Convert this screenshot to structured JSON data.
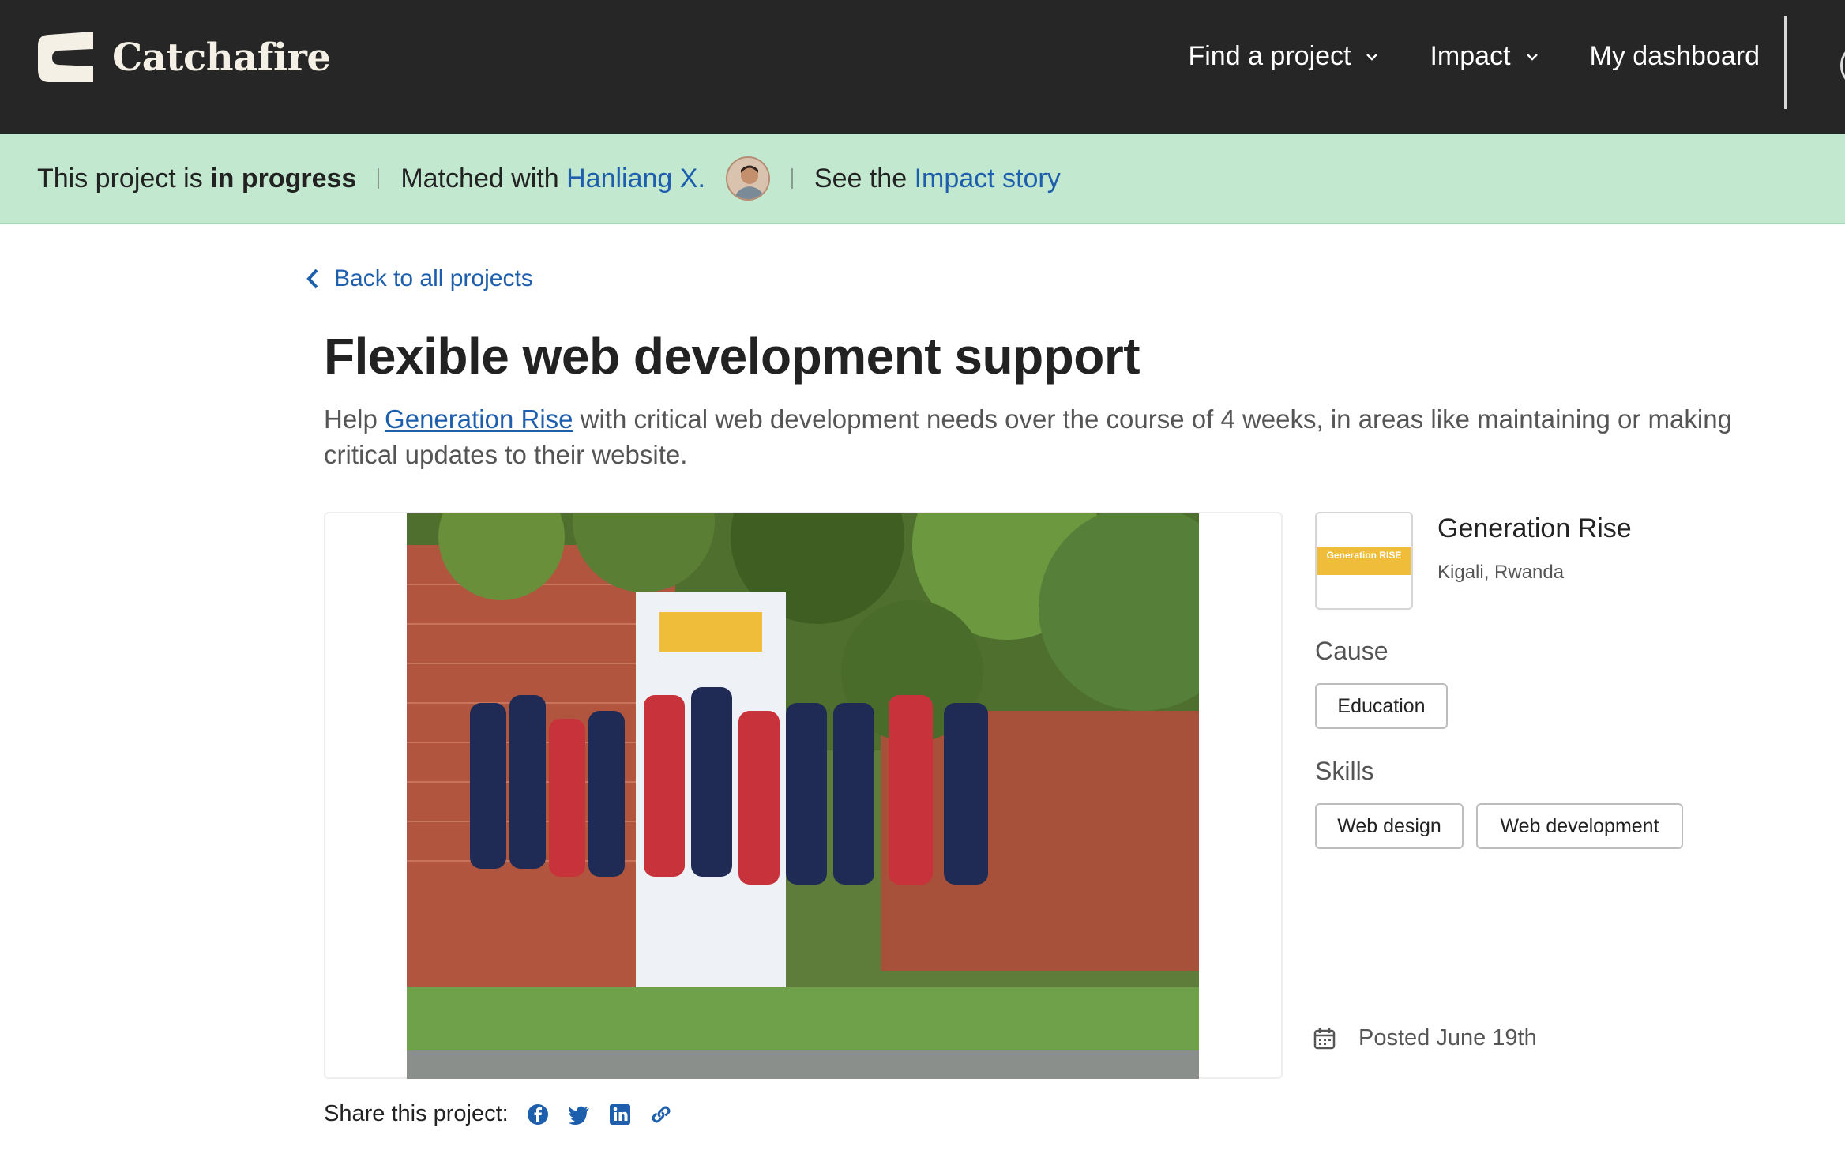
{
  "brand": {
    "name": "Catchafire"
  },
  "nav": {
    "items": [
      {
        "label": "Find a project",
        "dropdown": true
      },
      {
        "label": "Impact",
        "dropdown": true
      },
      {
        "label": "My dashboard",
        "dropdown": false
      }
    ]
  },
  "status": {
    "prefix": "This project is ",
    "state": "in progress",
    "matched_prefix": "Matched with ",
    "matched_name": "Hanliang X.",
    "impact_prefix": "See the ",
    "impact_link": "Impact story"
  },
  "back_link": "Back to all projects",
  "project": {
    "title": "Flexible web development support",
    "desc_prefix": "Help ",
    "desc_org": "Generation Rise",
    "desc_suffix": " with critical web development needs over the course of 4 weeks, in areas like maintaining or making critical updates to their website."
  },
  "org": {
    "name": "Generation Rise",
    "location": "Kigali, Rwanda",
    "logo_text": "Generation RISE"
  },
  "cause": {
    "label": "Cause",
    "tags": [
      "Education"
    ]
  },
  "skills": {
    "label": "Skills",
    "tags": [
      "Web design",
      "Web development"
    ]
  },
  "posted": "Posted June 19th",
  "share": {
    "label": "Share this project:",
    "icons": [
      "facebook-icon",
      "twitter-icon",
      "linkedin-icon",
      "link-icon"
    ]
  },
  "colors": {
    "nav_bg": "#262626",
    "status_bg": "#c2e9cf",
    "link": "#1e5fad",
    "logo": "#f5f0e6"
  }
}
